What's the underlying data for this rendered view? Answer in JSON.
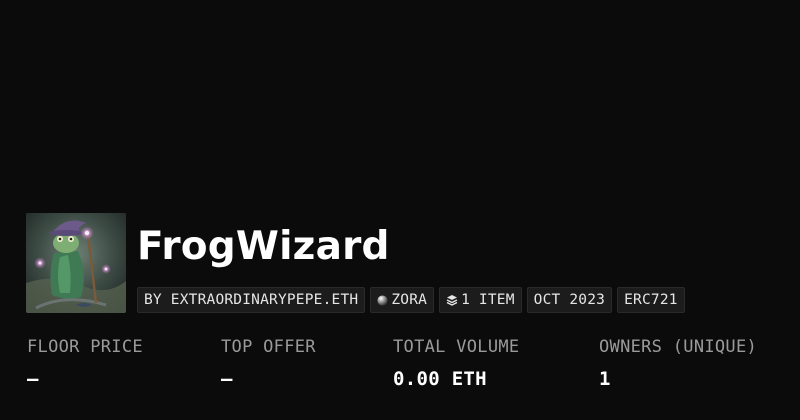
{
  "collection": {
    "name": "FrogWizard",
    "avatar_icon": "frog-wizard-artwork"
  },
  "badges": {
    "creator": "BY EXTRAORDINARYPEPE.ETH",
    "network": "ZORA",
    "network_icon": "zora-orb-icon",
    "items": "1 ITEM",
    "items_icon": "layers-icon",
    "date": "OCT 2023",
    "standard": "ERC721"
  },
  "stats": {
    "floor_price": {
      "label": "FLOOR PRICE",
      "value": "—"
    },
    "top_offer": {
      "label": "TOP OFFER",
      "value": "—"
    },
    "total_volume": {
      "label": "TOTAL VOLUME",
      "value": "0.00 ETH"
    },
    "owners": {
      "label": "OWNERS (UNIQUE)",
      "value": "1"
    }
  },
  "colors": {
    "background": "#0b0b0b",
    "badge_bg": "#1c1c1c",
    "label": "#9a9a9a",
    "value": "#ffffff"
  }
}
